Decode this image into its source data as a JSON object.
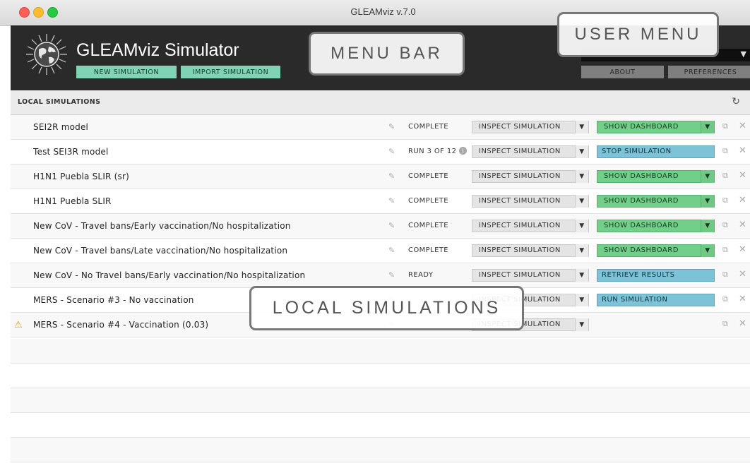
{
  "window": {
    "title": "GLEAMviz v.7.0"
  },
  "header": {
    "app_title": "GLEAMviz Simulator",
    "new_simulation": "NEW SIMULATION",
    "import_simulation": "IMPORT SIMULATION",
    "about": "ABOUT",
    "preferences": "PREFERENCES"
  },
  "section": {
    "title": "LOCAL SIMULATIONS"
  },
  "callouts": {
    "menu_bar": "MENU BAR",
    "user_menu": "USER MENU",
    "local_simulations": "LOCAL SIMULATIONS"
  },
  "simulations": [
    {
      "name": "SEI2R model",
      "status": "COMPLETE",
      "inspect": "INSPECT SIMULATION",
      "action": "SHOW DASHBOARD",
      "action_style": "green",
      "warning": false
    },
    {
      "name": "Test SEI3R model",
      "status": "RUN 3 OF 12",
      "inspect": "INSPECT SIMULATION",
      "action": "STOP SIMULATION",
      "action_style": "blue",
      "warning": false,
      "info": true
    },
    {
      "name": "H1N1 Puebla SLIR (sr)",
      "status": "COMPLETE",
      "inspect": "INSPECT SIMULATION",
      "action": "SHOW DASHBOARD",
      "action_style": "green",
      "warning": false
    },
    {
      "name": "H1N1 Puebla SLIR",
      "status": "COMPLETE",
      "inspect": "INSPECT SIMULATION",
      "action": "SHOW DASHBOARD",
      "action_style": "green",
      "warning": false
    },
    {
      "name": "New CoV - Travel bans/Early vaccination/No hospitalization",
      "status": "COMPLETE",
      "inspect": "INSPECT SIMULATION",
      "action": "SHOW DASHBOARD",
      "action_style": "green",
      "warning": false
    },
    {
      "name": "New CoV - Travel bans/Late vaccination/No hospitalization",
      "status": "COMPLETE",
      "inspect": "INSPECT SIMULATION",
      "action": "SHOW DASHBOARD",
      "action_style": "green",
      "warning": false
    },
    {
      "name": "New CoV - No Travel bans/Early vaccination/No hospitalization",
      "status": "READY",
      "inspect": "INSPECT SIMULATION",
      "action": "RETRIEVE RESULTS",
      "action_style": "blue",
      "warning": false
    },
    {
      "name": "MERS - Scenario #3 - No vaccination",
      "status": "",
      "inspect": "INSPECT SIMULATION",
      "action": "RUN SIMULATION",
      "action_style": "blue",
      "warning": false
    },
    {
      "name": "MERS - Scenario #4 - Vaccination (0.03)",
      "status": "",
      "inspect": "INSPECT SIMULATION",
      "action": "",
      "action_style": "none",
      "warning": true
    }
  ],
  "icons": {
    "edit": "pencil-icon",
    "info": "info-icon",
    "copy": "copy-icon",
    "remove": "close-icon",
    "refresh": "refresh-icon",
    "warning": "warning-icon",
    "logo": "globe-logo-icon"
  }
}
